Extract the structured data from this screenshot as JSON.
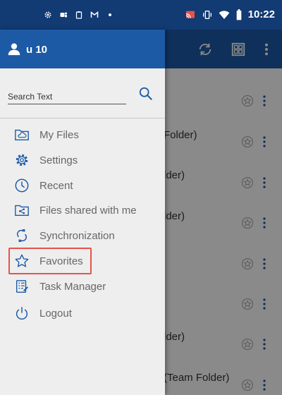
{
  "status_bar": {
    "time": "10:22",
    "left_icons": [
      "gear-icon",
      "teams-icon",
      "clipboard-icon",
      "gmail-icon",
      "dot-icon"
    ],
    "right_icons": [
      "cast-icon",
      "vibrate-icon",
      "wifi-icon",
      "battery-icon"
    ]
  },
  "drawer": {
    "user_name": "u 10",
    "search_placeholder": "Search Text",
    "menu": [
      {
        "label": "My Files",
        "icon": "folder-cloud-icon"
      },
      {
        "label": "Settings",
        "icon": "gear-icon"
      },
      {
        "label": "Recent",
        "icon": "clock-icon"
      },
      {
        "label": "Files shared with me",
        "icon": "shared-folder-icon"
      },
      {
        "label": "Synchronization",
        "icon": "sync-icon"
      },
      {
        "label": "Favorites",
        "icon": "star-icon"
      },
      {
        "label": "Task Manager",
        "icon": "task-list-icon"
      },
      {
        "label": "Logout",
        "icon": "power-icon"
      }
    ]
  },
  "background": {
    "header_actions": [
      "sync-icon",
      "grid-view-icon",
      "more-vert-icon"
    ],
    "rows": [
      {
        "text": ""
      },
      {
        "text": "Folder)"
      },
      {
        "text": "lder)"
      },
      {
        "text": "lder)"
      },
      {
        "text": ""
      },
      {
        "text": ""
      },
      {
        "text": "lder)"
      },
      {
        "text": "(Team Folder)"
      }
    ]
  },
  "colors": {
    "status_bar": "#123a73",
    "header": "#1c5aa6",
    "drawer_bg": "#eeeeee",
    "highlight": "#e5534b"
  }
}
